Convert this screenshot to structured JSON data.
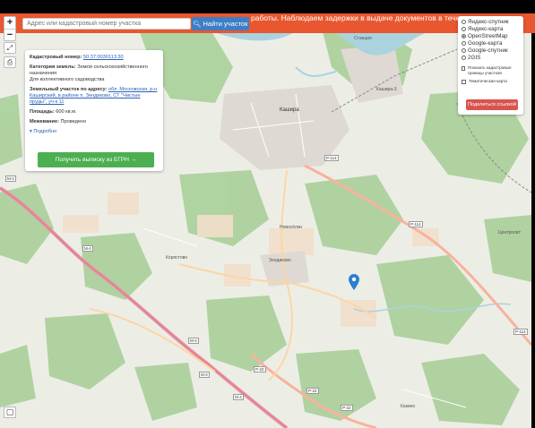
{
  "banner": {
    "message": "работы. Наблюдаем задержки в выдаче документов в течение дня."
  },
  "search": {
    "placeholder": "Адрес или кадастровый номер участка",
    "button_label": "Найти участок"
  },
  "zoom": {
    "in": "+",
    "out": "−"
  },
  "info": {
    "cadastral_label": "Кадастровый номер:",
    "cadastral_value": "50:37:0030113:30",
    "category_label": "Категория земель:",
    "category_value": "Земли сельскохозяйственного назначения",
    "usage_value": "Для коллективного садоводства",
    "address_label": "Земельный участок по адресу:",
    "address_value": "обл. Московская, р-н Каширский, в районе п. Зендиково, СТ \"Чистые пруды\", уч-к 11",
    "area_label": "Площадь:",
    "area_value": "600 кв.м.",
    "survey_label": "Межевание:",
    "survey_value": "Проведено",
    "more_label": "Подробно",
    "egrn_button": "Получить выписку из ЕГРН →"
  },
  "layers": {
    "options": [
      {
        "label": "Яндекс-спутник",
        "selected": false
      },
      {
        "label": "Яндекс-карта",
        "selected": false
      },
      {
        "label": "OpenStreetMap",
        "selected": true
      },
      {
        "label": "Google-карта",
        "selected": false
      },
      {
        "label": "Google-спутник",
        "selected": false
      },
      {
        "label": "2GIS",
        "selected": false
      }
    ],
    "show_borders": "Показать кадастровые границы участков",
    "thematic": "Тематическая карта",
    "share_button": "Поделиться ссылкой"
  },
  "map_labels": {
    "kashira": "Кашира",
    "kashira3": "Кашира-3",
    "stantsiya": "Станция",
    "zendikovo": "Зендиково",
    "koryastovo": "Корястово",
    "tsentrolit": "Центролит",
    "kakino": "Какино",
    "novoselki": "Новосёлки",
    "r114_a": "P-114",
    "r114_b": "P-114",
    "r114_c": "P-114",
    "m4_a": "М-4",
    "m4_b": "М-4",
    "m4_c": "М-4",
    "m4_d": "М-4",
    "m4_e": "М-4",
    "r22_a": "P-22",
    "r22_b": "P-22",
    "r22_c": "P-22"
  },
  "colors": {
    "banner": "#e8572f",
    "search_button": "#3f7ec6",
    "egrn_button": "#4caf50",
    "share_button": "#d9534f",
    "water": "#aad3df",
    "forest": "#add19e",
    "marker": "#2a7fd1"
  }
}
